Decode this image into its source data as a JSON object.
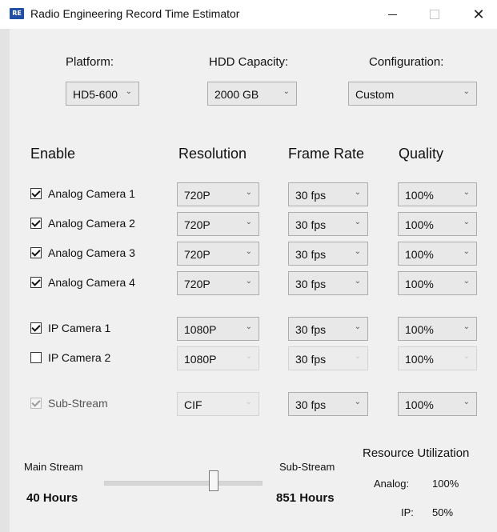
{
  "window": {
    "title": "Radio Engineering Record Time Estimator",
    "icon_text": "RE",
    "controls": {
      "minimize": "—",
      "maximize": "☐",
      "close": "✕"
    }
  },
  "top": {
    "platform_label": "Platform:",
    "platform_value": "HD5-600",
    "hdd_label": "HDD Capacity:",
    "hdd_value": "2000 GB",
    "config_label": "Configuration:",
    "config_value": "Custom"
  },
  "headers": {
    "enable": "Enable",
    "resolution": "Resolution",
    "frame_rate": "Frame Rate",
    "quality": "Quality"
  },
  "rows": [
    {
      "label": "Analog Camera 1",
      "checked": true,
      "enabled": true,
      "resolution": "720P",
      "res_enabled": true,
      "fps": "30 fps",
      "fps_enabled": true,
      "quality": "100%",
      "q_enabled": true
    },
    {
      "label": "Analog Camera 2",
      "checked": true,
      "enabled": true,
      "resolution": "720P",
      "res_enabled": true,
      "fps": "30 fps",
      "fps_enabled": true,
      "quality": "100%",
      "q_enabled": true
    },
    {
      "label": "Analog Camera 3",
      "checked": true,
      "enabled": true,
      "resolution": "720P",
      "res_enabled": true,
      "fps": "30 fps",
      "fps_enabled": true,
      "quality": "100%",
      "q_enabled": true
    },
    {
      "label": "Analog Camera 4",
      "checked": true,
      "enabled": true,
      "resolution": "720P",
      "res_enabled": true,
      "fps": "30 fps",
      "fps_enabled": true,
      "quality": "100%",
      "q_enabled": true
    },
    {
      "label": "IP Camera 1",
      "checked": true,
      "enabled": true,
      "resolution": "1080P",
      "res_enabled": true,
      "fps": "30 fps",
      "fps_enabled": true,
      "quality": "100%",
      "q_enabled": true
    },
    {
      "label": "IP Camera 2",
      "checked": false,
      "enabled": true,
      "resolution": "1080P",
      "res_enabled": false,
      "fps": "30 fps",
      "fps_enabled": false,
      "quality": "100%",
      "q_enabled": false
    },
    {
      "label": "Sub-Stream",
      "checked": true,
      "enabled": false,
      "resolution": "CIF",
      "res_enabled": false,
      "fps": "30 fps",
      "fps_enabled": true,
      "quality": "100%",
      "q_enabled": true
    }
  ],
  "bottom": {
    "main_stream_label": "Main Stream",
    "main_stream_hours": "40 Hours",
    "sub_stream_label": "Sub-Stream",
    "sub_stream_hours": "851 Hours",
    "resource_title": "Resource Utilization",
    "analog_label": "Analog:",
    "analog_value": "100%",
    "ip_label": "IP:",
    "ip_value": "50%"
  },
  "slider": {
    "value": 0.7
  }
}
